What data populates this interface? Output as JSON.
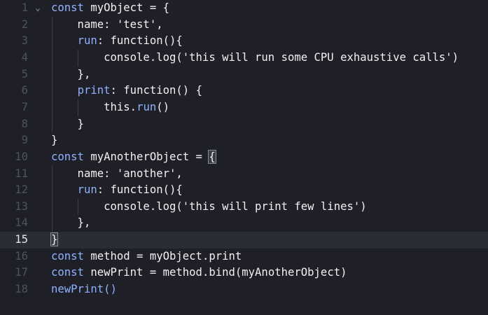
{
  "editor": {
    "active_line": 15,
    "lines": [
      {
        "n": "1",
        "fold": "⌄",
        "tokens": [
          {
            "t": "const",
            "c": "kw"
          },
          {
            "t": " myObject = {",
            "c": ""
          }
        ]
      },
      {
        "n": "2",
        "tokens": [
          {
            "t": "    name: 'test',",
            "c": ""
          }
        ]
      },
      {
        "n": "3",
        "tokens": [
          {
            "t": "    ",
            "c": ""
          },
          {
            "t": "run",
            "c": "kw"
          },
          {
            "t": ": function(){",
            "c": ""
          }
        ]
      },
      {
        "n": "4",
        "tokens": [
          {
            "t": "        console.log('this will run some CPU exhaustive calls')",
            "c": ""
          }
        ]
      },
      {
        "n": "5",
        "tokens": [
          {
            "t": "    },",
            "c": ""
          }
        ]
      },
      {
        "n": "6",
        "tokens": [
          {
            "t": "    ",
            "c": ""
          },
          {
            "t": "print",
            "c": "kw"
          },
          {
            "t": ": function() {",
            "c": ""
          }
        ]
      },
      {
        "n": "7",
        "tokens": [
          {
            "t": "        this.",
            "c": ""
          },
          {
            "t": "run",
            "c": "kw"
          },
          {
            "t": "()",
            "c": ""
          }
        ]
      },
      {
        "n": "8",
        "tokens": [
          {
            "t": "    }",
            "c": ""
          }
        ]
      },
      {
        "n": "9",
        "tokens": [
          {
            "t": "}",
            "c": ""
          }
        ]
      },
      {
        "n": "10",
        "tokens": [
          {
            "t": "const",
            "c": "kw"
          },
          {
            "t": " myAnotherObject = ",
            "c": ""
          },
          {
            "t": "{",
            "c": "brace"
          }
        ]
      },
      {
        "n": "11",
        "tokens": [
          {
            "t": "    name: 'another',",
            "c": ""
          }
        ]
      },
      {
        "n": "12",
        "tokens": [
          {
            "t": "    ",
            "c": ""
          },
          {
            "t": "run",
            "c": "kw"
          },
          {
            "t": ": function(){",
            "c": ""
          }
        ]
      },
      {
        "n": "13",
        "tokens": [
          {
            "t": "        console.log('this will print few lines')",
            "c": ""
          }
        ]
      },
      {
        "n": "14",
        "tokens": [
          {
            "t": "    },",
            "c": ""
          }
        ]
      },
      {
        "n": "15",
        "tokens": [
          {
            "t": "}",
            "c": "brace"
          },
          {
            "t": "const method = myObject.print",
            "c": ""
          }
        ]
      },
      {
        "n": "16",
        "tokens": [
          {
            "t": "const",
            "c": "kw"
          },
          {
            "t": " method = myObject.print",
            "c": ""
          }
        ]
      },
      {
        "n": "17",
        "tokens": [
          {
            "t": "const",
            "c": "kw"
          },
          {
            "t": " newPrint = method.bind(myAnotherObject)",
            "c": ""
          }
        ]
      },
      {
        "n": "18",
        "tokens": [
          {
            "t": "newPrint()",
            "c": "kw"
          }
        ]
      }
    ]
  }
}
